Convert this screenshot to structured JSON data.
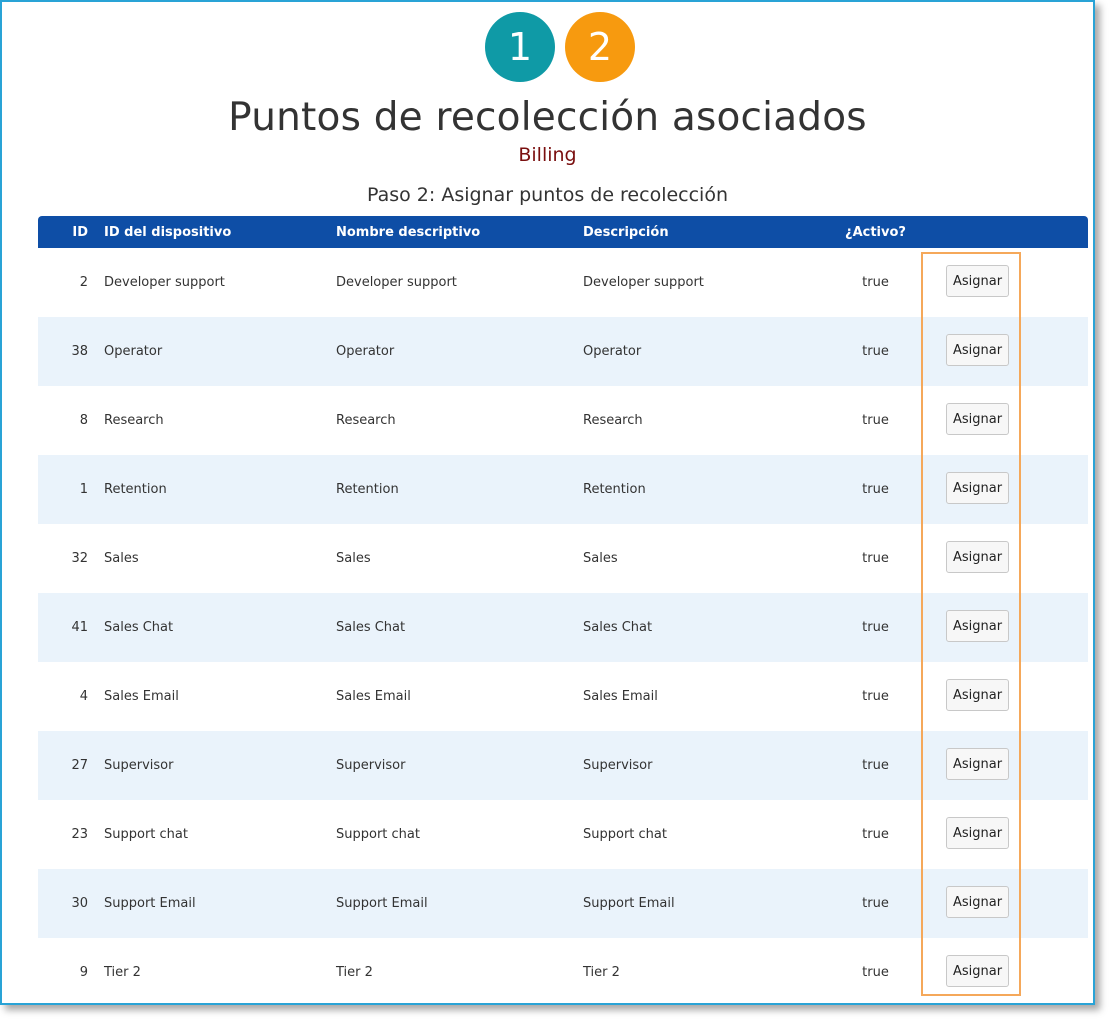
{
  "wizard": {
    "steps": [
      "1",
      "2"
    ],
    "title": "Puntos de recolección asociados",
    "subtitle": "Billing",
    "step_label": "Paso 2: Asignar puntos de recolección"
  },
  "colors": {
    "step1": "#0f9aa6",
    "step2": "#f79a0f",
    "header_bg": "#0e4ea6",
    "subtitle": "#7a0f0f",
    "stripe": "#eaf3fb",
    "highlight": "#f5a85a",
    "frame_border": "#29a3d6"
  },
  "table": {
    "headers": {
      "id": "ID",
      "device": "ID del dispositivo",
      "name": "Nombre descriptivo",
      "description": "Descripción",
      "active": "¿Activo?"
    },
    "button_label": "Asignar",
    "rows": [
      {
        "id": "2",
        "device": "Developer support",
        "name": "Developer support",
        "description": "Developer support",
        "active": "true"
      },
      {
        "id": "38",
        "device": "Operator",
        "name": "Operator",
        "description": "Operator",
        "active": "true"
      },
      {
        "id": "8",
        "device": "Research",
        "name": "Research",
        "description": "Research",
        "active": "true"
      },
      {
        "id": "1",
        "device": "Retention",
        "name": "Retention",
        "description": "Retention",
        "active": "true"
      },
      {
        "id": "32",
        "device": "Sales",
        "name": "Sales",
        "description": "Sales",
        "active": "true"
      },
      {
        "id": "41",
        "device": "Sales Chat",
        "name": "Sales Chat",
        "description": "Sales Chat",
        "active": "true"
      },
      {
        "id": "4",
        "device": "Sales Email",
        "name": "Sales Email",
        "description": "Sales Email",
        "active": "true"
      },
      {
        "id": "27",
        "device": "Supervisor",
        "name": "Supervisor",
        "description": "Supervisor",
        "active": "true"
      },
      {
        "id": "23",
        "device": "Support chat",
        "name": "Support chat",
        "description": "Support chat",
        "active": "true"
      },
      {
        "id": "30",
        "device": "Support Email",
        "name": "Support Email",
        "description": "Support Email",
        "active": "true"
      },
      {
        "id": "9",
        "device": "Tier 2",
        "name": "Tier 2",
        "description": "Tier 2",
        "active": "true"
      }
    ]
  }
}
